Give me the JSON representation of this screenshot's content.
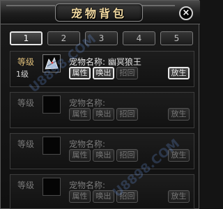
{
  "window": {
    "title": "宠物背包",
    "close_glyph": "×"
  },
  "tabs": [
    {
      "label": "1",
      "active": true
    },
    {
      "label": "2",
      "active": false
    },
    {
      "label": "3",
      "active": false
    },
    {
      "label": "4",
      "active": false
    },
    {
      "label": "5",
      "active": false
    }
  ],
  "slots": [
    {
      "level_label": "等级",
      "level_value": "1级",
      "name_text": "宠物名称: 幽冥狼王",
      "buttons": [
        "属性",
        "唤出",
        "招回"
      ],
      "release": "放生"
    },
    {
      "level_label": "等级",
      "name_text": "宠物名称:",
      "buttons": [
        "属性",
        "唤出",
        "招回"
      ],
      "release": "放生"
    },
    {
      "level_label": "等级",
      "name_text": "宠物名称:",
      "buttons": [
        "属性",
        "唤出",
        "招回"
      ],
      "release": "放生"
    },
    {
      "level_label": "等级",
      "name_text": "宠物名称:",
      "buttons": [
        "属性",
        "唤出",
        "招回"
      ],
      "release": "放生"
    }
  ],
  "watermark": [
    "U8898.COM",
    "U8898.COM"
  ],
  "colors": {
    "title": "#f0d8a0",
    "level_label": "#e0bf7a",
    "active_border": "#e6e6e6"
  }
}
